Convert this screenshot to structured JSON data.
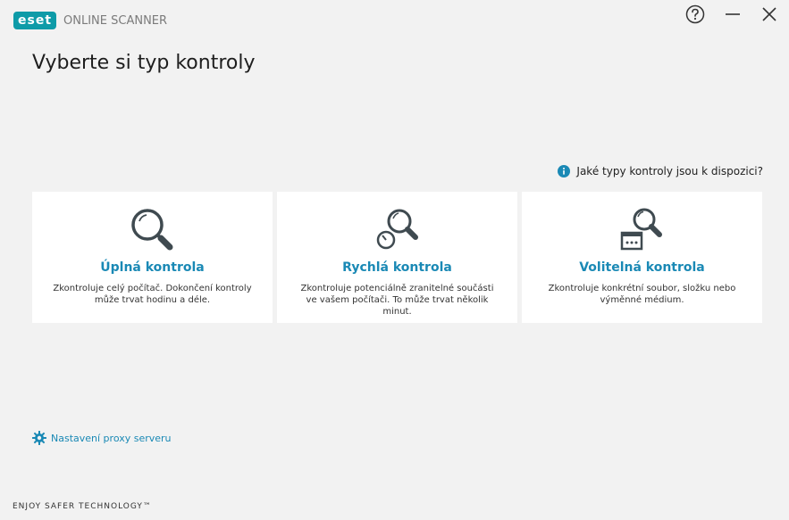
{
  "app": {
    "logo_text": "eset",
    "product_name": "ONLINE SCANNER",
    "brand_color": "#0e9ba8",
    "accent_color": "#1a89b5"
  },
  "window_controls": {
    "help_icon": "help-circle-icon",
    "minimize_icon": "minimize-icon",
    "close_icon": "close-icon"
  },
  "main": {
    "title": "Vyberte si typ kontroly",
    "info_link": "Jaké typy kontroly jsou k dispozici?",
    "cards": [
      {
        "icon": "magnifier-icon",
        "title": "Úplná kontrola",
        "description": "Zkontroluje celý počítač. Dokončení kontroly může trvat hodinu a déle."
      },
      {
        "icon": "quick-scan-icon",
        "title": "Rychlá kontrola",
        "description": "Zkontroluje potenciálně zranitelné součásti ve vašem počítači. To může trvat několik minut."
      },
      {
        "icon": "custom-scan-icon",
        "title": "Volitelná kontrola",
        "description": "Zkontroluje konkrétní soubor, složku nebo výměnné médium."
      }
    ],
    "proxy_link": "Nastavení proxy serveru"
  },
  "footer": {
    "tagline": "ENJOY SAFER TECHNOLOGY™"
  }
}
